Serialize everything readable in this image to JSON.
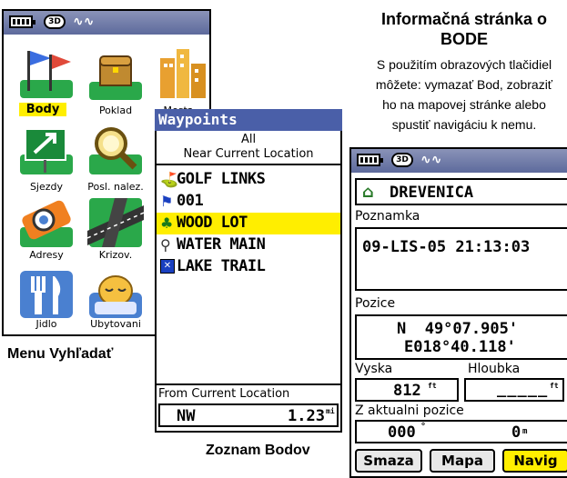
{
  "menu": {
    "caption": "Menu Vyhľadať",
    "tiles": [
      {
        "label": "Body",
        "icon": "flags-icon",
        "selected": true
      },
      {
        "label": "Poklad",
        "icon": "treasure-chest-icon",
        "selected": false
      },
      {
        "label": "Mesta",
        "icon": "city-buildings-icon",
        "selected": false
      },
      {
        "label": "Sjezdy",
        "icon": "exit-sign-icon",
        "selected": false
      },
      {
        "label": "Posl. nalez.",
        "icon": "magnifier-icon",
        "selected": false
      },
      {
        "label": "Adresy",
        "icon": "address-finder-icon",
        "selected": false
      },
      {
        "label": "Krizov.",
        "icon": "intersection-icon",
        "selected": false
      },
      {
        "label": "Jidlo",
        "icon": "fork-knife-icon",
        "selected": false
      },
      {
        "label": "Ubytovani",
        "icon": "sleeping-face-icon",
        "selected": false
      }
    ]
  },
  "waypoints": {
    "title": "Waypoints",
    "filter_line1": "All",
    "filter_line2": "Near Current Location",
    "items": [
      {
        "name": "GOLF LINKS",
        "icon": "golf-icon",
        "selected": false
      },
      {
        "name": "001",
        "icon": "blue-flag-icon",
        "selected": false
      },
      {
        "name": "WOOD LOT",
        "icon": "tree-icon",
        "selected": true
      },
      {
        "name": "WATER MAIN",
        "icon": "water-tap-icon",
        "selected": false
      },
      {
        "name": "LAKE TRAIL",
        "icon": "trail-icon",
        "selected": false
      }
    ],
    "from_label": "From Current Location",
    "direction": "NW",
    "distance": "1.23",
    "distance_unit": "mi",
    "caption": "Zoznam Bodov"
  },
  "info": {
    "heading_line1": "Informačná stránka o",
    "heading_line2": "BODE",
    "desc": [
      "S použitím obrazových tlačidiel",
      "môžete: vymazať Bod, zobraziť",
      "ho na mapovej stránke alebo",
      "spustiť navigáciu k nemu."
    ]
  },
  "detail": {
    "name": "DREVENICA",
    "note_label": "Poznamka",
    "note_value": "09-LIS-05 21:13:03",
    "position_label": "Pozice",
    "lat": "N  49°07.905'",
    "lon": "E018°40.118'",
    "altitude_label": "Vyska",
    "altitude_value": "812",
    "altitude_unit": "ft",
    "depth_label": "Hloubka",
    "depth_value": "_____",
    "depth_unit": "ft",
    "from_label": "Z aktualni pozice",
    "bearing_value": "000",
    "bearing_unit": "°",
    "distance_value": "0",
    "distance_unit": "m",
    "buttons": {
      "delete": "Smaza",
      "map": "Mapa",
      "navigate": "Navig"
    }
  },
  "colors": {
    "title_bar": "#4a5fa8",
    "highlight": "#ffee00",
    "status_bar": "#6b76a8"
  }
}
